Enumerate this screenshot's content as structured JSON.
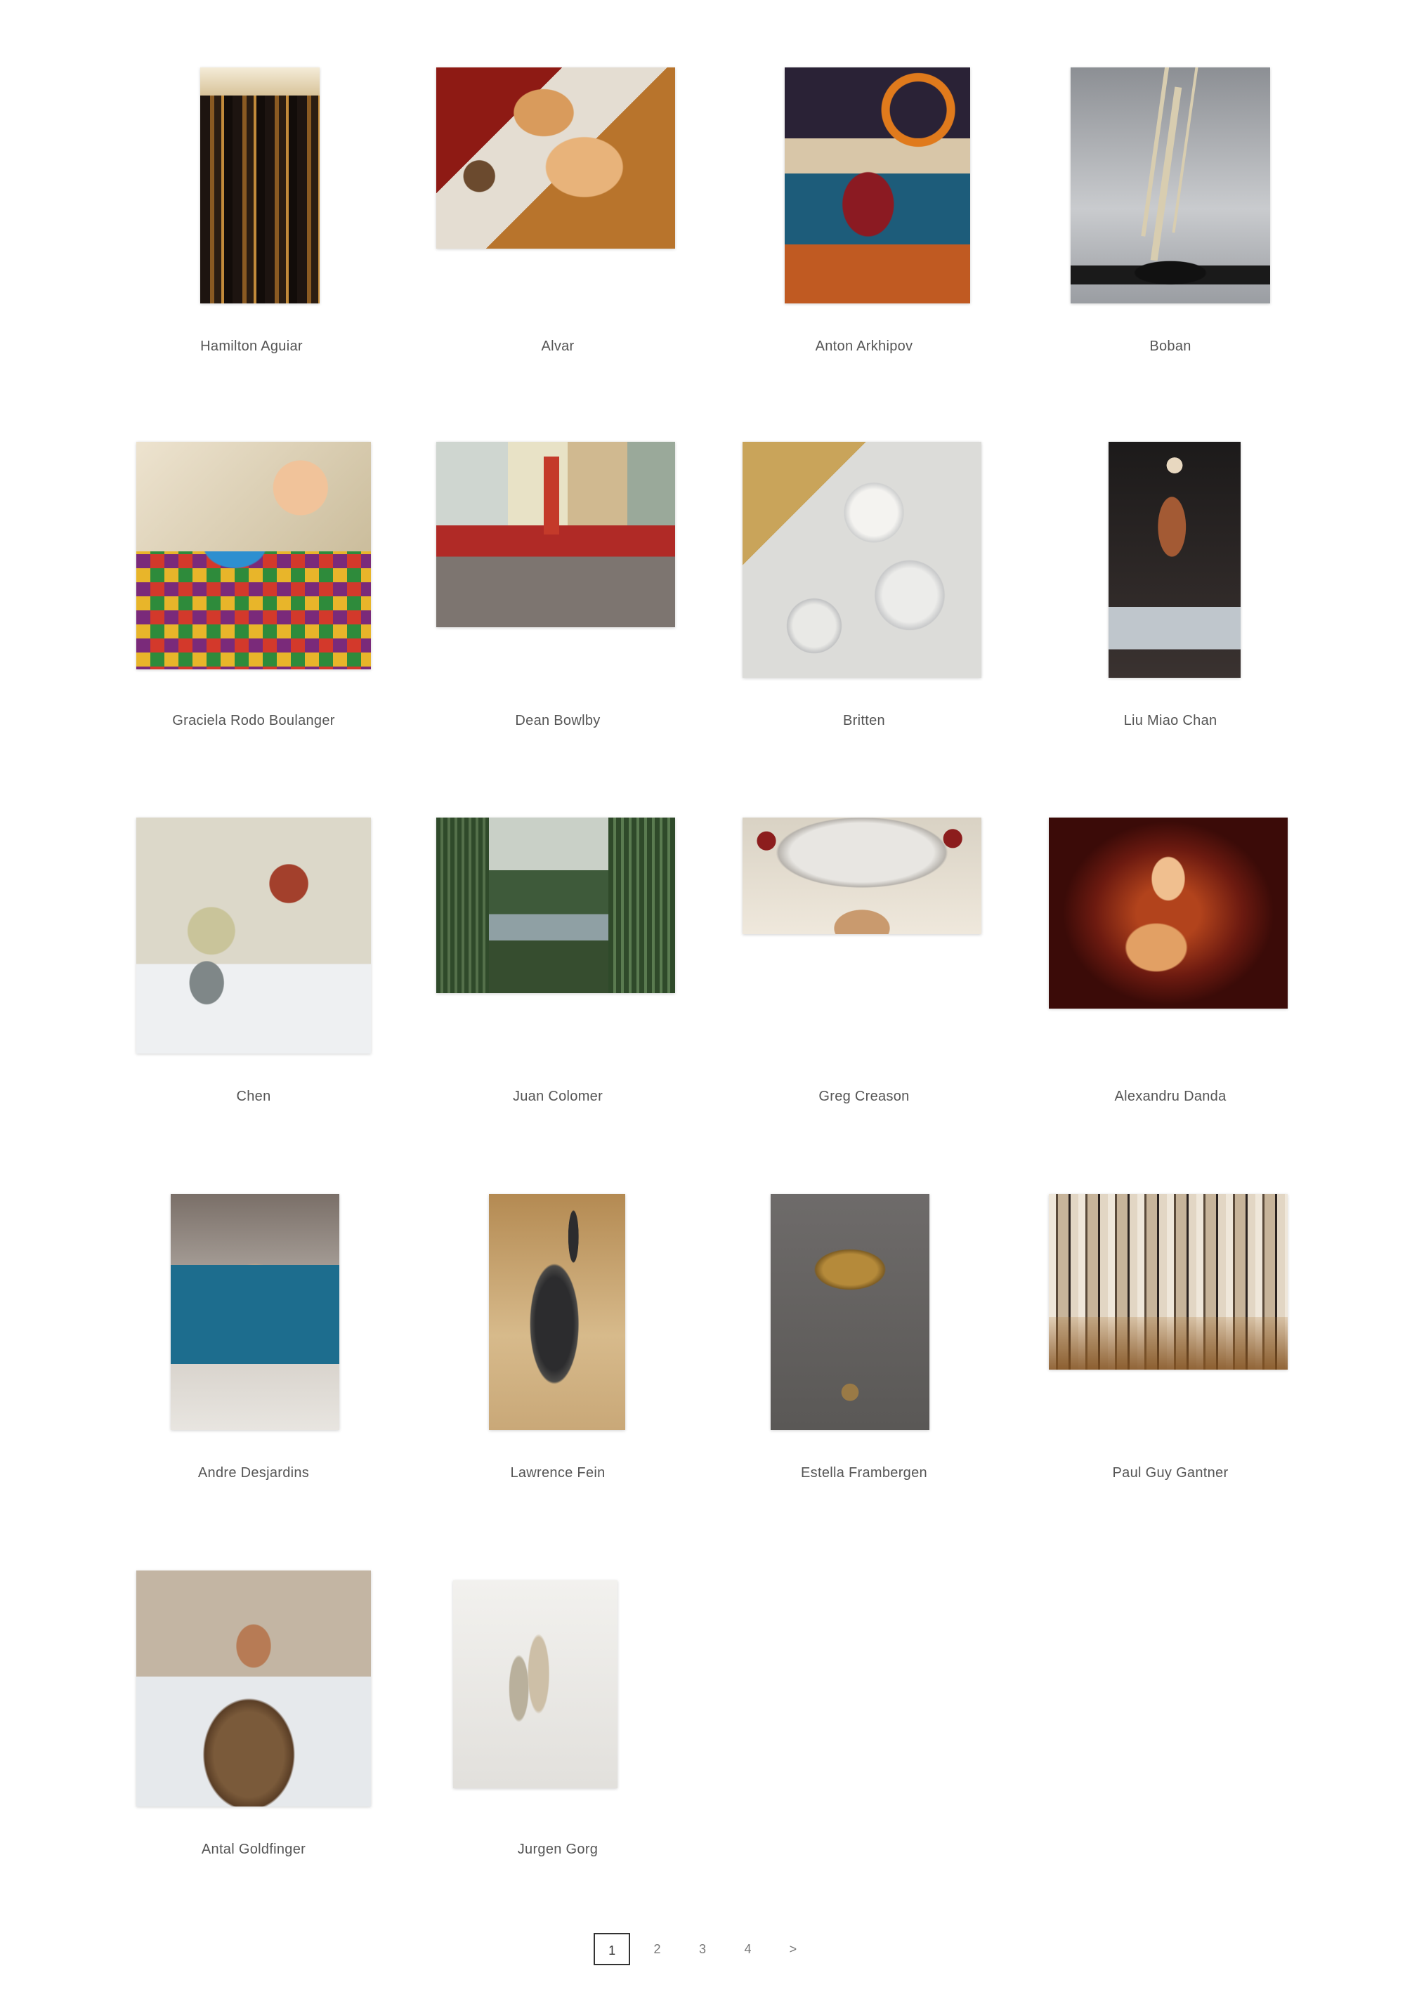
{
  "artists": [
    {
      "name": "Hamilton Aguiar"
    },
    {
      "name": "Alvar"
    },
    {
      "name": "Anton Arkhipov"
    },
    {
      "name": "Boban"
    },
    {
      "name": "Graciela Rodo Boulanger"
    },
    {
      "name": "Dean Bowlby"
    },
    {
      "name": "Britten"
    },
    {
      "name": "Liu Miao Chan"
    },
    {
      "name": "Chen"
    },
    {
      "name": "Juan Colomer"
    },
    {
      "name": "Greg Creason"
    },
    {
      "name": "Alexandru Danda"
    },
    {
      "name": "Andre Desjardins"
    },
    {
      "name": "Lawrence Fein"
    },
    {
      "name": "Estella Frambergen"
    },
    {
      "name": "Paul Guy Gantner"
    },
    {
      "name": "Antal Goldfinger"
    },
    {
      "name": "Jurgen Gorg"
    }
  ],
  "pagination": {
    "pages": [
      "1",
      "2",
      "3",
      "4"
    ],
    "current": "1",
    "next_label": ">"
  }
}
